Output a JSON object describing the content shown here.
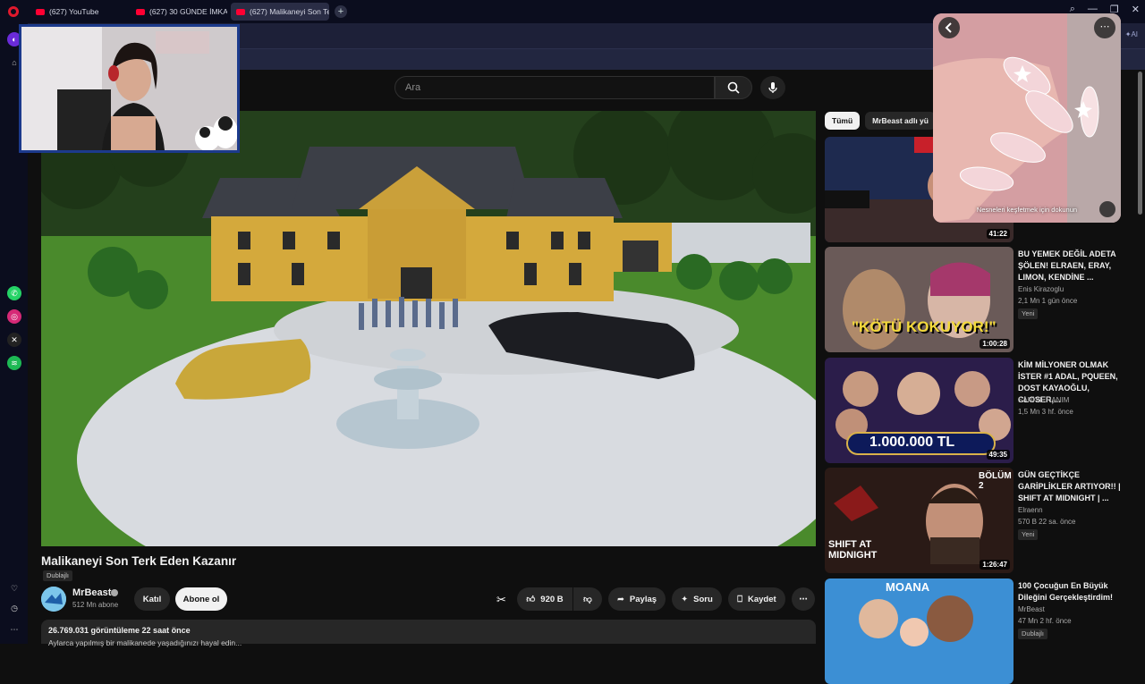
{
  "tabs": [
    {
      "label": "(627) YouTube",
      "active": false
    },
    {
      "label": "(627) 30 GÜNDE İMKANSI",
      "active": false
    },
    {
      "label": "(627) Malikaneyi Son Teri",
      "active": true
    }
  ],
  "search": {
    "placeholder": "Ara"
  },
  "video": {
    "title": "Malikaneyi Son Terk Eden Kazanır",
    "dub_badge": "Dublajlı",
    "channel": "MrBeast",
    "subscribers": "512 Mn abone",
    "join_label": "Katıl",
    "subscribe_label": "Abone ol",
    "likes": "920 B",
    "share_label": "Paylaş",
    "ask_label": "Soru",
    "save_label": "Kaydet",
    "views_line": "26.769.031 görüntüleme  22 saat önce",
    "desc_partial": "Aylarca yapılmış bir malikanede yaşadığınızı hayal edin..."
  },
  "chips": [
    {
      "label": "Tümü",
      "active": true
    },
    {
      "label": "MrBeast adlı yü",
      "active": false
    }
  ],
  "recommendations": [
    {
      "title": "",
      "channel": "",
      "meta": "",
      "badge": "",
      "duration": "41:22",
      "thumb_color": "#1e2a4f"
    },
    {
      "title": "BU YEMEK DEĞİL ADETA ŞÖLEN! ELRAEN, ERAY, LIMON, KENDİNE ...",
      "channel": "Enis Kirazoglu",
      "meta": "2,1 Mn  1 gün önce",
      "badge": "Yeni",
      "duration": "1:00:28",
      "thumb_text": "\"KÖTÜ KOKUYOR!\"",
      "thumb_color": "#5a4a48"
    },
    {
      "title": "KİM MİLYONER OLMAK İSTER #1 ADAL, PQUEEN, DOST KAYAOĞLU, CLOSER,...",
      "channel": "SANİYE HANIM",
      "meta": "1,5 Mn  3 hf. önce",
      "badge": "",
      "duration": "49:35",
      "thumb_text": "1.000.000 TL",
      "thumb_color": "#2b1d4a"
    },
    {
      "title": "GÜN GEÇTİKÇE GARİPLİKLER ARTIYOR!! | SHIFT AT MIDNIGHT | ...",
      "channel": "Elraenn",
      "meta": "570 B  22 sa. önce",
      "badge": "Yeni",
      "duration": "1:26:47",
      "thumb_text": "SHIFT AT MIDNIGHT",
      "thumb_label2": "BÖLÜM 2",
      "thumb_color": "#2a1a16"
    },
    {
      "title": "100 Çocuğun En Büyük Dileğini Gerçekleştirdim!",
      "channel": "MrBeast",
      "meta": "47 Mn  2 hf. önce",
      "badge": "Dublajlı",
      "duration": "",
      "thumb_text": "MOANA",
      "thumb_color": "#3c8fd4"
    }
  ],
  "mini_player": {
    "hint": "Nesneleri keşfetmek için dokunun"
  },
  "sidebar_icons": [
    "opera-logo",
    "whatsapp-icon",
    "instagram-icon",
    "x-icon",
    "spotify-icon",
    "heart-icon",
    "history-icon",
    "more-icon"
  ],
  "colors": {
    "accent": "#ff0033",
    "background": "#0f0f0f",
    "browser": "#0b0d1e"
  }
}
